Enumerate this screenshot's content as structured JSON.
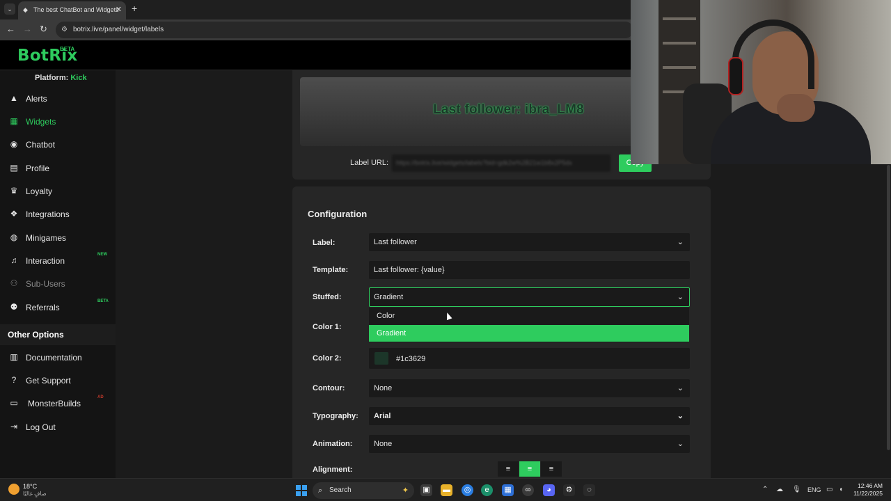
{
  "browser": {
    "tab_title": "The best ChatBot and Widgets",
    "tab_list_icon": "chevron-down-icon",
    "tab_close": "✕",
    "new_tab": "+",
    "url": "botrix.live/panel/widget/labels"
  },
  "app": {
    "logo": "BotRix",
    "logo_badge": "BETA",
    "platform_label": "Platform:",
    "platform_value": "Kick",
    "accent_color": "#2ecc5e"
  },
  "sidebar": {
    "items": [
      {
        "label": "Alerts",
        "icon": "warning-icon",
        "glyph": "▲"
      },
      {
        "label": "Widgets",
        "icon": "grid-icon",
        "glyph": "▦"
      },
      {
        "label": "Chatbot",
        "icon": "robot-icon",
        "glyph": "◉"
      },
      {
        "label": "Profile",
        "icon": "id-card-icon",
        "glyph": "▤"
      },
      {
        "label": "Loyalty",
        "icon": "trophy-icon",
        "glyph": "♛"
      },
      {
        "label": "Integrations",
        "icon": "cubes-icon",
        "glyph": "❖"
      },
      {
        "label": "Minigames",
        "icon": "gamepad-icon",
        "glyph": "◍"
      },
      {
        "label": "Interaction",
        "icon": "music-icon",
        "glyph": "♫",
        "badge": "NEW"
      },
      {
        "label": "Sub-Users",
        "icon": "users-icon",
        "glyph": "⚇"
      },
      {
        "label": "Referrals",
        "icon": "user-group-icon",
        "glyph": "⚉",
        "badge": "BETA"
      }
    ],
    "other_title": "Other Options",
    "other_items": [
      {
        "label": "Documentation",
        "icon": "book-icon",
        "glyph": "▥"
      },
      {
        "label": "Get Support",
        "icon": "question-icon",
        "glyph": "?"
      },
      {
        "label": "MonsterBuilds",
        "icon": "laptop-icon",
        "glyph": "▭"
      },
      {
        "label": "Log Out",
        "icon": "logout-icon",
        "glyph": "⇥"
      }
    ]
  },
  "preview": {
    "text": "Last follower: ibra_LM8",
    "url_label": "Label URL:",
    "url_value": "https://botrix.live/widgets/labels?bid=gdk2w%2B21w1b8x2P5dx",
    "copy_label": "Copy"
  },
  "config": {
    "title": "Configuration",
    "label_label": "Label:",
    "label_value": "Last follower",
    "template_label": "Template:",
    "template_value": "Last follower: {value}",
    "stuffed_label": "Stuffed:",
    "stuffed_value": "Gradient",
    "stuffed_options": [
      "Color",
      "Gradient"
    ],
    "color1_label": "Color 1:",
    "color2_label": "Color 2:",
    "color2_value": "#1c3629",
    "contour_label": "Contour:",
    "contour_value": "None",
    "typography_label": "Typography:",
    "typography_value": "Arial",
    "animation_label": "Animation:",
    "animation_value": "None",
    "alignment_label": "Alignment:",
    "alignment_selected": "center"
  },
  "taskbar": {
    "temperature": "18°C",
    "weather_desc": "صافٍ غالبًا",
    "search_label": "Search",
    "language": "ENG",
    "time": "12:46 AM",
    "date": "11/22/2025"
  }
}
